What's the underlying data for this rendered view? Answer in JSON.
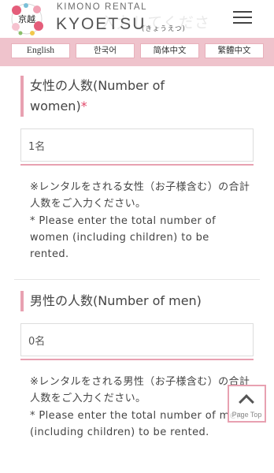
{
  "header": {
    "ghost_text": "入力してくださ",
    "brand_sub": "KIMONO RENTAL",
    "brand_main": "KYOETSU",
    "brand_kana": "(きょうえつ)",
    "logo_text": "京越"
  },
  "languages": [
    "English",
    "한국어",
    "简体中文",
    "繁體中文"
  ],
  "women": {
    "title": "女性の人数(Number of women)",
    "required_mark": "*",
    "value": "1名",
    "note_ja": "※レンタルをされる女性（お子様含む）の合計人数をご入力ください。",
    "note_en": "* Please enter the total number of women (including children) to be rented."
  },
  "men": {
    "title": "男性の人数(Number of men)",
    "value": "0名",
    "note_ja": "※レンタルをされる男性（お子様含む）の合計人数をご入力ください。",
    "note_en": "* Please enter the total number of men (including children) to be rented."
  },
  "page_top": {
    "label": "Page Top"
  },
  "colors": {
    "accent": "#e8a1b1",
    "lang_bar": "#efc3cc",
    "required": "#e2486a"
  }
}
